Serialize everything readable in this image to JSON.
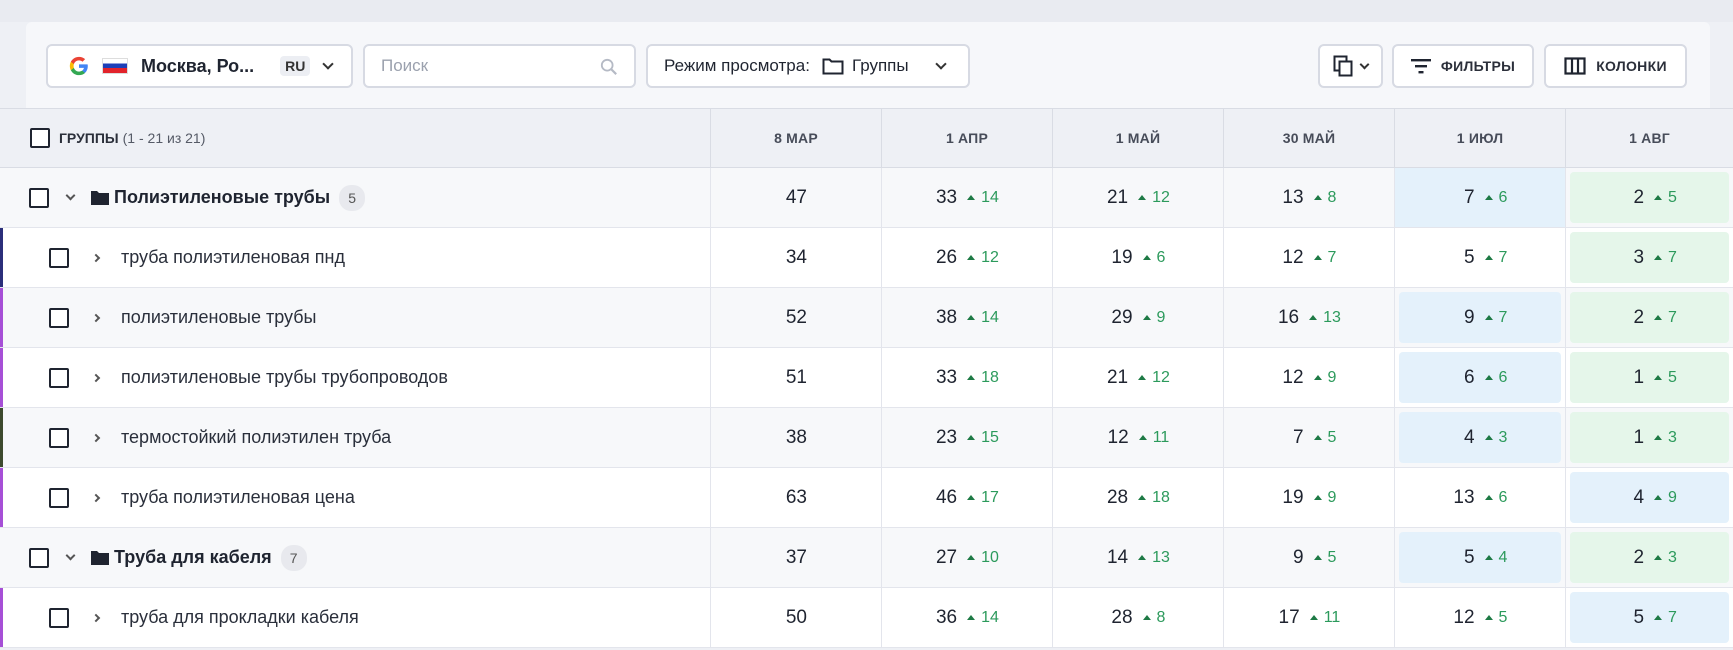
{
  "toolbar": {
    "location": "Москва, Ро...",
    "language": "RU",
    "search_placeholder": "Поиск",
    "view_mode_label": "Режим просмотра:",
    "view_mode_value": "Группы",
    "filters_label": "ФИЛЬТРЫ",
    "columns_label": "КОЛОНКИ"
  },
  "table": {
    "header": {
      "groups_label": "ГРУППЫ",
      "groups_count": "(1 - 21 из 21)",
      "dates": [
        "8 МАР",
        "1 АПР",
        "1 МАЙ",
        "30 МАЙ",
        "1 ИЮЛ",
        "1 АВГ"
      ]
    },
    "rows": [
      {
        "type": "group",
        "name": "Полиэтиленовые трубы",
        "count": "5",
        "accent": "",
        "cells": [
          {
            "pos": "47",
            "delta": "",
            "hl": ""
          },
          {
            "pos": "33",
            "delta": "14",
            "hl": ""
          },
          {
            "pos": "21",
            "delta": "12",
            "hl": ""
          },
          {
            "pos": "13",
            "delta": "8",
            "hl": ""
          },
          {
            "pos": "7",
            "delta": "6",
            "hl": "blue-full"
          },
          {
            "pos": "2",
            "delta": "5",
            "hl": "green"
          }
        ]
      },
      {
        "type": "keyword",
        "name": "труба полиэтиленовая пнд",
        "accent": "#2b2f7a",
        "cells": [
          {
            "pos": "34",
            "delta": "",
            "hl": ""
          },
          {
            "pos": "26",
            "delta": "12",
            "hl": ""
          },
          {
            "pos": "19",
            "delta": "6",
            "hl": ""
          },
          {
            "pos": "12",
            "delta": "7",
            "hl": ""
          },
          {
            "pos": "5",
            "delta": "7",
            "hl": ""
          },
          {
            "pos": "3",
            "delta": "7",
            "hl": "green"
          }
        ]
      },
      {
        "type": "keyword",
        "name": "полиэтиленовые трубы",
        "accent": "#a64fd6",
        "cells": [
          {
            "pos": "52",
            "delta": "",
            "hl": ""
          },
          {
            "pos": "38",
            "delta": "14",
            "hl": ""
          },
          {
            "pos": "29",
            "delta": "9",
            "hl": ""
          },
          {
            "pos": "16",
            "delta": "13",
            "hl": ""
          },
          {
            "pos": "9",
            "delta": "7",
            "hl": "blue"
          },
          {
            "pos": "2",
            "delta": "7",
            "hl": "green"
          }
        ]
      },
      {
        "type": "keyword",
        "name": "полиэтиленовые трубы трубопроводов",
        "accent": "#a64fd6",
        "cells": [
          {
            "pos": "51",
            "delta": "",
            "hl": ""
          },
          {
            "pos": "33",
            "delta": "18",
            "hl": ""
          },
          {
            "pos": "21",
            "delta": "12",
            "hl": ""
          },
          {
            "pos": "12",
            "delta": "9",
            "hl": ""
          },
          {
            "pos": "6",
            "delta": "6",
            "hl": "blue"
          },
          {
            "pos": "1",
            "delta": "5",
            "hl": "green"
          }
        ]
      },
      {
        "type": "keyword",
        "name": "термостойкий полиэтилен труба",
        "accent": "#3d4a2e",
        "cells": [
          {
            "pos": "38",
            "delta": "",
            "hl": ""
          },
          {
            "pos": "23",
            "delta": "15",
            "hl": ""
          },
          {
            "pos": "12",
            "delta": "11",
            "hl": ""
          },
          {
            "pos": "7",
            "delta": "5",
            "hl": ""
          },
          {
            "pos": "4",
            "delta": "3",
            "hl": "blue"
          },
          {
            "pos": "1",
            "delta": "3",
            "hl": "green"
          }
        ]
      },
      {
        "type": "keyword",
        "name": "труба полиэтиленовая цена",
        "accent": "#a64fd6",
        "cells": [
          {
            "pos": "63",
            "delta": "",
            "hl": ""
          },
          {
            "pos": "46",
            "delta": "17",
            "hl": ""
          },
          {
            "pos": "28",
            "delta": "18",
            "hl": ""
          },
          {
            "pos": "19",
            "delta": "9",
            "hl": ""
          },
          {
            "pos": "13",
            "delta": "6",
            "hl": ""
          },
          {
            "pos": "4",
            "delta": "9",
            "hl": "blue"
          }
        ]
      },
      {
        "type": "group",
        "name": "Труба для кабеля",
        "count": "7",
        "accent": "",
        "cells": [
          {
            "pos": "37",
            "delta": "",
            "hl": ""
          },
          {
            "pos": "27",
            "delta": "10",
            "hl": ""
          },
          {
            "pos": "14",
            "delta": "13",
            "hl": ""
          },
          {
            "pos": "9",
            "delta": "5",
            "hl": ""
          },
          {
            "pos": "5",
            "delta": "4",
            "hl": "blue"
          },
          {
            "pos": "2",
            "delta": "3",
            "hl": "green"
          }
        ]
      },
      {
        "type": "keyword",
        "name": "труба для прокладки кабеля",
        "accent": "#a64fd6",
        "cells": [
          {
            "pos": "50",
            "delta": "",
            "hl": ""
          },
          {
            "pos": "36",
            "delta": "14",
            "hl": ""
          },
          {
            "pos": "28",
            "delta": "8",
            "hl": ""
          },
          {
            "pos": "17",
            "delta": "11",
            "hl": ""
          },
          {
            "pos": "12",
            "delta": "5",
            "hl": ""
          },
          {
            "pos": "5",
            "delta": "7",
            "hl": "blue"
          }
        ]
      }
    ]
  }
}
